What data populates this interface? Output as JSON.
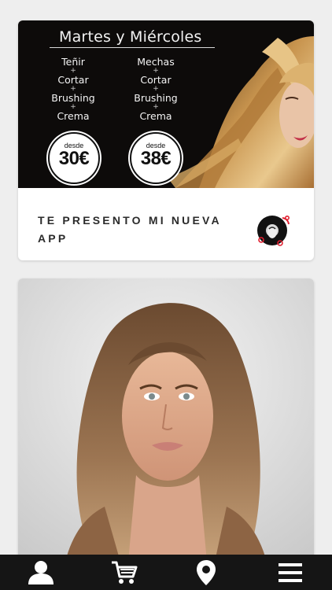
{
  "promo": {
    "title": "Martes y Miércoles",
    "left_items": [
      "Teñir",
      "Cortar",
      "Brushing",
      "Crema"
    ],
    "right_items": [
      "Mechas",
      "Cortar",
      "Brushing",
      "Crema"
    ],
    "plus": "+",
    "left_price_prefix": "desde",
    "left_price": "30€",
    "right_price_prefix": "desde",
    "right_price": "38€"
  },
  "card1": {
    "caption": "TE PRESENTO MI NUEVA APP"
  },
  "tabbar": {
    "icons": [
      "user-icon",
      "cart-icon",
      "location-pin-icon",
      "menu-icon"
    ],
    "background": "#151515"
  }
}
